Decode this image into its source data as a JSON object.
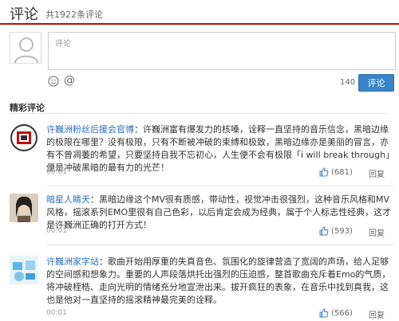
{
  "header": {
    "title": "评论",
    "count": "共1922条评论"
  },
  "composer": {
    "placeholder": "评论",
    "char_count": "140",
    "submit_label": "评论"
  },
  "section_title": "精彩评论",
  "comments": [
    {
      "user": "许巍洲粉丝后援会官博",
      "text": "：许巍洲富有爆发力的核嗓，诠释一直坚持的音乐信念，黑暗边缘的极限在哪里？没有极限，只有不断被冲破的束缚和极致，黑暗边缘亦是美丽的冒言，亦有不曾凋萎的希望，只要坚持自我不忘初心，人生便不会有极限「i will break through」便是冲破黑暗的最有力的光芒！",
      "time": "00:01",
      "likes": "(681)",
      "reply": "回复"
    },
    {
      "user": "暗星人睛天",
      "text": "：黑暗边缘这个MV很有质感，带动性，视觉冲击很强烈，这种音乐风格和MV风格，摇滚系列EMO里很有自己色彩，以后肯定会成为经典，属于个人标志性经典，这才是许巍洲正确的打开方式！",
      "time": "00:01",
      "likes": "(593)",
      "reply": "回复"
    },
    {
      "user": "许巍洲家字站",
      "text": "：歌曲开始用厚重的失真音色、氛围化的旋律营造了宽阔的声场，给人足够的空间感和想象力。重要的人声段落烘托出强烈的压迫感，整首歌曲充斥着Emo的气质，将冲破桎梏、走向光明的情绪充分地宣泄出来。拔开疯狂的表象，在音乐中找到真我，这也是他对一直坚持的摇滚精神最完美的诠释。",
      "time": "00:01",
      "likes": "(566)",
      "reply": "回复"
    }
  ],
  "icons": {
    "like": "thumbs-up-icon",
    "emoji": "smile-icon",
    "at": "at-icon"
  },
  "colors": {
    "accent_red": "#c20c0c",
    "link_blue": "#2a6ec0",
    "button_blue": "#3a84c8"
  }
}
